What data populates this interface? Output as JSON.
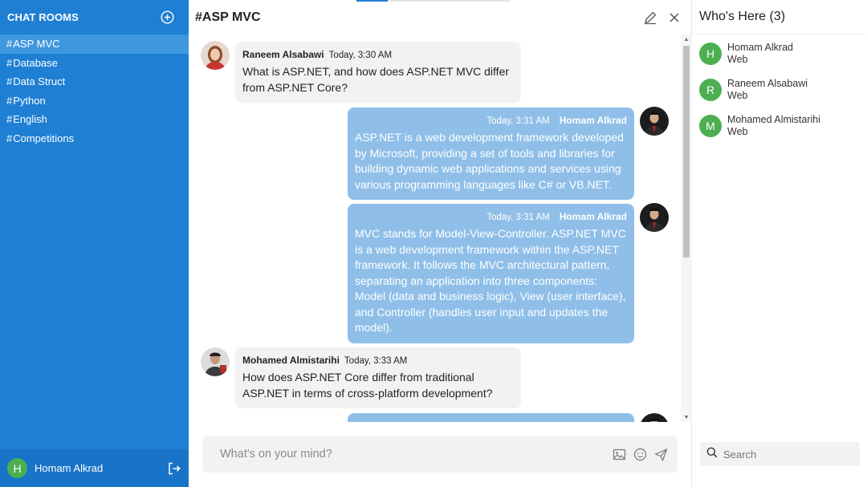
{
  "sidebar": {
    "title": "CHAT ROOMS",
    "rooms": [
      {
        "hash": "#",
        "label": "ASP MVC"
      },
      {
        "hash": "#",
        "label": "Database"
      },
      {
        "hash": "#",
        "label": "Data Struct"
      },
      {
        "hash": "#",
        "label": "Python"
      },
      {
        "hash": "#",
        "label": "English"
      },
      {
        "hash": "#",
        "label": "Competitions"
      }
    ],
    "active_room": "ASP MVC",
    "current_user": {
      "initial": "H",
      "name": "Homam Alkrad"
    }
  },
  "header": {
    "room_title": "#ASP MVC"
  },
  "messages": [
    {
      "author": "Raneem Alsabawi",
      "time": "Today, 3:30 AM",
      "text": "What is ASP.NET, and how does ASP.NET MVC differ from ASP.NET Core?",
      "direction": "incoming"
    },
    {
      "author": "Homam Alkrad",
      "time": "Today, 3:31 AM",
      "text": "ASP.NET is a web development framework developed by Microsoft, providing a set of tools and libraries for building dynamic web applications and services using various programming languages like C# or VB.NET.",
      "direction": "outgoing"
    },
    {
      "author": "Homam Alkrad",
      "time": "Today, 3:31 AM",
      "text": "MVC stands for Model-View-Controller. ASP.NET MVC is a web development framework within the ASP.NET framework. It follows the MVC architectural pattern, separating an application into three components: Model (data and business logic), View (user interface), and Controller (handles user input and updates the model).",
      "direction": "outgoing"
    },
    {
      "author": "Mohamed Almistarihi",
      "time": "Today, 3:33 AM",
      "text": "How does ASP.NET Core differ from traditional ASP.NET in terms of cross-platform development?",
      "direction": "incoming"
    }
  ],
  "composer": {
    "placeholder": "What's on your mind?"
  },
  "presence": {
    "title": "Who's Here (3)",
    "users": [
      {
        "initial": "H",
        "name": "Homam Alkrad",
        "status": "Web"
      },
      {
        "initial": "R",
        "name": "Raneem Alsabawi",
        "status": "Web"
      },
      {
        "initial": "M",
        "name": "Mohamed Almistarihi",
        "status": "Web"
      }
    ],
    "search_placeholder": "Search"
  },
  "colors": {
    "sidebar": "#1e7fd3",
    "active_room": "#3f97e0",
    "outgoing_bubble": "#8fbfe8",
    "incoming_bubble": "#f2f2f2",
    "avatar_green": "#4caf50"
  }
}
